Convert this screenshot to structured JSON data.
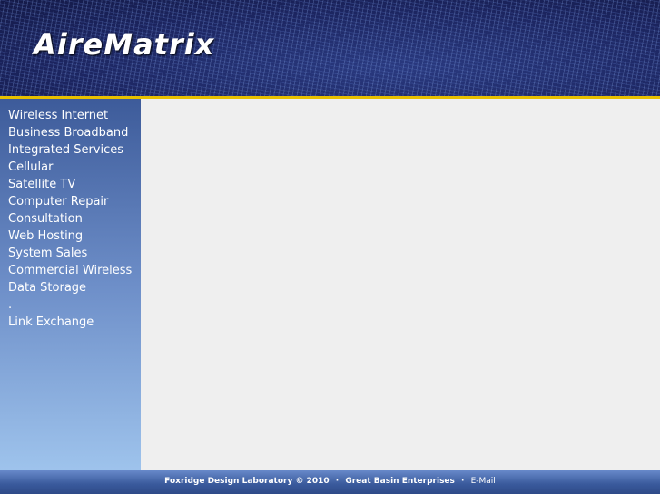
{
  "header": {
    "logo": "AireMatrix"
  },
  "sidebar": {
    "items": [
      "Wireless Internet",
      "Business Broadband",
      "Integrated Services",
      "Cellular",
      "Satellite TV",
      "Computer Repair",
      "Consultation",
      "Web Hosting",
      "System Sales",
      "Commercial Wireless",
      "Data Storage",
      ".",
      "Link Exchange"
    ]
  },
  "footer": {
    "company": "Foxridge Design Laboratory © 2010",
    "sep1": "·",
    "partner": "Great Basin Enterprises",
    "sep2": "·",
    "email": "E-Mail"
  },
  "colors": {
    "accent_rule": "#e8c000",
    "content_bg": "#efefef"
  }
}
